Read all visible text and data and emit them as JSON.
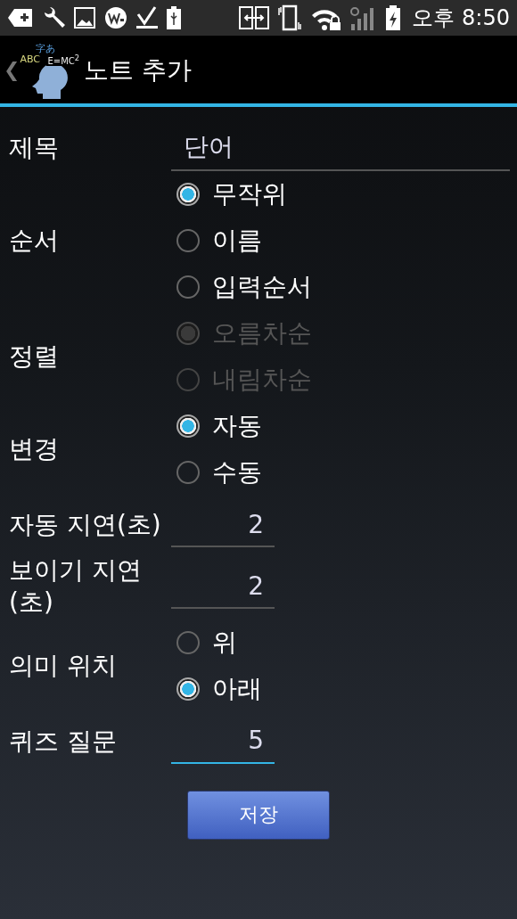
{
  "status_bar": {
    "time": "오후 8:50"
  },
  "action_bar": {
    "back": "❮",
    "logo_text": [
      "字あ",
      "ABC",
      "E=MC$^{2}$"
    ],
    "title": "노트 추가"
  },
  "form": [
    {
      "kind": "text",
      "label": "제목",
      "value": "단어",
      "focused": false
    },
    {
      "kind": "radio",
      "label": "순서",
      "options": [
        {
          "label": "무작위",
          "selected": true,
          "disabled": false
        },
        {
          "label": "이름",
          "selected": false,
          "disabled": false
        },
        {
          "label": "입력순서",
          "selected": false,
          "disabled": false
        }
      ]
    },
    {
      "kind": "radio",
      "label": "정렬",
      "options": [
        {
          "label": "오름차순",
          "selected": true,
          "disabled": true
        },
        {
          "label": "내림차순",
          "selected": false,
          "disabled": true
        }
      ]
    },
    {
      "kind": "radio",
      "label": "변경",
      "options": [
        {
          "label": "자동",
          "selected": true,
          "disabled": false
        },
        {
          "label": "수동",
          "selected": false,
          "disabled": false
        }
      ]
    },
    {
      "kind": "number",
      "label": "자동 지연(초)",
      "value": "2",
      "focused": false
    },
    {
      "kind": "number",
      "label": "보이기 지연(초)",
      "value": "2",
      "focused": false
    },
    {
      "kind": "radio",
      "label": "의미 위치",
      "options": [
        {
          "label": "위",
          "selected": false,
          "disabled": false
        },
        {
          "label": "아래",
          "selected": true,
          "disabled": false
        }
      ]
    },
    {
      "kind": "number",
      "label": "퀴즈 질문",
      "value": "5",
      "focused": true
    }
  ],
  "save_button": "저장"
}
